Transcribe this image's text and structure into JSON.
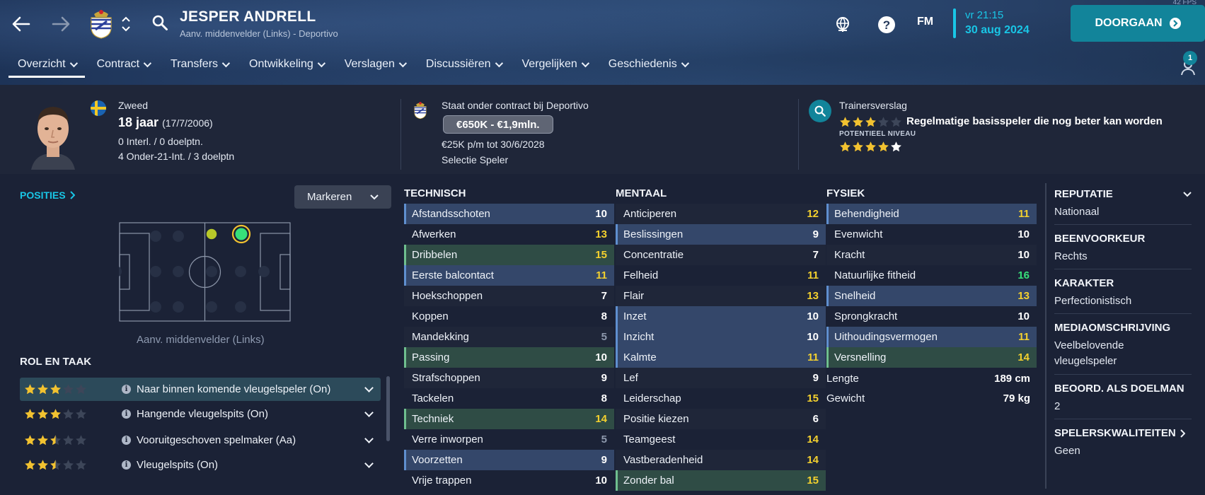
{
  "header": {
    "player_name": "JESPER ANDRELL",
    "player_subtitle": "Aanv. middenvelder (Links) - Deportivo",
    "time": "vr 21:15",
    "date": "30 aug 2024",
    "continue_label": "DOORGAAN",
    "fm_label": "FM",
    "fps": "42 FPS",
    "notification_count": "1",
    "icons": [
      "back-arrow-icon",
      "forward-arrow-icon",
      "club-crest-icon",
      "up-down-icon",
      "search-icon",
      "globe-icon",
      "help-icon",
      "notifications-icon"
    ]
  },
  "tabs": [
    {
      "label": "Overzicht",
      "active": true
    },
    {
      "label": "Contract"
    },
    {
      "label": "Transfers"
    },
    {
      "label": "Ontwikkeling"
    },
    {
      "label": "Verslagen"
    },
    {
      "label": "Discussiëren"
    },
    {
      "label": "Vergelijken"
    },
    {
      "label": "Geschiedenis"
    }
  ],
  "info": {
    "nationality": "Zweed",
    "age": "18 jaar",
    "dob": "(17/7/2006)",
    "caps": "0 Interl. / 0 doelptn.",
    "u21": "4 Onder-21-Int. / 3 doelptn",
    "contract_title": "Staat onder contract bij Deportivo",
    "value": "€650K - €1,9mln.",
    "wage": "€25K p/m tot 30/6/2028",
    "squad_status": "Selectie Speler",
    "scout_title": "Trainersverslag",
    "scout_summary": "Regelmatige basisspeler die nog beter kan worden",
    "current_stars": 3,
    "potential_label": "POTENTIEEL NIVEAU",
    "potential_stars": 4
  },
  "positions": {
    "link_label": "POSITIES",
    "mark_button": "Markeren",
    "caption": "Aanv. middenvelder (Links)"
  },
  "roles": {
    "title": "ROL EN TAAK",
    "items": [
      {
        "label": "Naar binnen komende vleugelspeler (On)",
        "stars": 3,
        "selected": true
      },
      {
        "label": "Hangende vleugelspits (On)",
        "stars": 3
      },
      {
        "label": "Vooruitgeschoven spelmaker (Aa)",
        "stars": 2.5
      },
      {
        "label": "Vleugelspits (On)",
        "stars": 2.5
      }
    ]
  },
  "technical": {
    "title": "TECHNISCH",
    "rows": [
      {
        "label": "Afstandsschoten",
        "value": "10",
        "hl": "blue"
      },
      {
        "label": "Afwerken",
        "value": "13"
      },
      {
        "label": "Dribbelen",
        "value": "15",
        "hl": "green"
      },
      {
        "label": "Eerste balcontact",
        "value": "11",
        "hl": "blue"
      },
      {
        "label": "Hoekschoppen",
        "value": "7"
      },
      {
        "label": "Koppen",
        "value": "8"
      },
      {
        "label": "Mandekking",
        "value": "5"
      },
      {
        "label": "Passing",
        "value": "10",
        "hl": "green"
      },
      {
        "label": "Strafschoppen",
        "value": "9"
      },
      {
        "label": "Tackelen",
        "value": "8"
      },
      {
        "label": "Techniek",
        "value": "14",
        "hl": "green"
      },
      {
        "label": "Verre inworpen",
        "value": "5"
      },
      {
        "label": "Voorzetten",
        "value": "9",
        "hl": "blue"
      },
      {
        "label": "Vrije trappen",
        "value": "10"
      }
    ]
  },
  "mental": {
    "title": "MENTAAL",
    "rows": [
      {
        "label": "Anticiperen",
        "value": "12"
      },
      {
        "label": "Beslissingen",
        "value": "9",
        "hl": "blue"
      },
      {
        "label": "Concentratie",
        "value": "7"
      },
      {
        "label": "Felheid",
        "value": "11"
      },
      {
        "label": "Flair",
        "value": "13"
      },
      {
        "label": "Inzet",
        "value": "10",
        "hl": "blue"
      },
      {
        "label": "Inzicht",
        "value": "10",
        "hl": "blue"
      },
      {
        "label": "Kalmte",
        "value": "11",
        "hl": "blue"
      },
      {
        "label": "Lef",
        "value": "9"
      },
      {
        "label": "Leiderschap",
        "value": "15"
      },
      {
        "label": "Positie kiezen",
        "value": "6"
      },
      {
        "label": "Teamgeest",
        "value": "14"
      },
      {
        "label": "Vastberadenheid",
        "value": "14"
      },
      {
        "label": "Zonder bal",
        "value": "15",
        "hl": "green"
      }
    ]
  },
  "physical": {
    "title": "FYSIEK",
    "rows": [
      {
        "label": "Behendigheid",
        "value": "11",
        "hl": "blue"
      },
      {
        "label": "Evenwicht",
        "value": "10"
      },
      {
        "label": "Kracht",
        "value": "10"
      },
      {
        "label": "Natuurlijke fitheid",
        "value": "16"
      },
      {
        "label": "Snelheid",
        "value": "13",
        "hl": "blue"
      },
      {
        "label": "Sprongkracht",
        "value": "10"
      },
      {
        "label": "Uithoudingsvermogen",
        "value": "11",
        "hl": "blue"
      },
      {
        "label": "Versnelling",
        "value": "14",
        "hl": "green"
      }
    ],
    "height_label": "Lengte",
    "height_value": "189 cm",
    "weight_label": "Gewicht",
    "weight_value": "79 kg"
  },
  "profile": {
    "reputation_label": "REPUTATIE",
    "reputation_value": "Nationaal",
    "foot_label": "BEENVOORKEUR",
    "foot_value": "Rechts",
    "personality_label": "KARAKTER",
    "personality_value": "Perfectionistisch",
    "media_label": "MEDIAOMSCHRIJVING",
    "media_value": "Veelbelovende vleugelspeler",
    "gk_label": "BEOORD. ALS DOELMAN",
    "gk_value": "2",
    "traits_label": "SPELERSKWALITEITEN",
    "traits_value": "Geen"
  },
  "colors": {
    "accent": "#19c6e6",
    "button": "#12849a",
    "star": "#f2c230",
    "attr_yellow": "#f4d12e",
    "attr_green": "#37e07a",
    "attr_grey": "#8e99ad"
  }
}
